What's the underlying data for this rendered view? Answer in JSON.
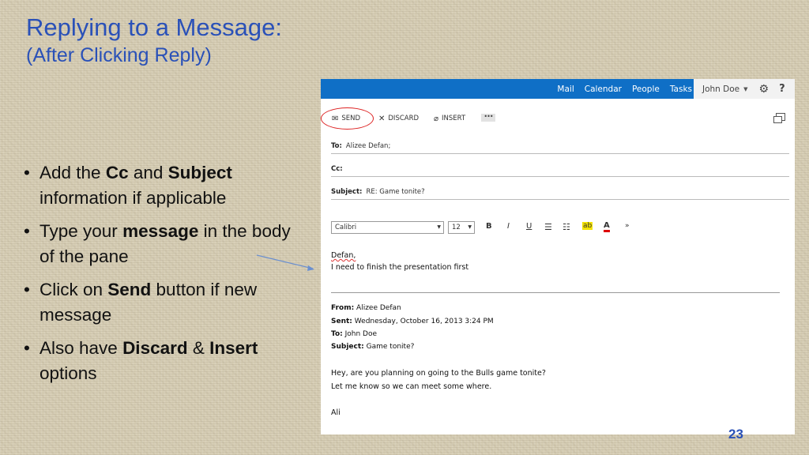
{
  "slide": {
    "title_line1": "Replying to a Message:",
    "title_line2": "(After Clicking Reply)",
    "bullets": [
      {
        "pre": "Add the ",
        "b1": "Cc",
        "mid": " and ",
        "b2": "Subject",
        "post": " information if applicable"
      },
      {
        "pre": "Type your ",
        "b1": "message",
        "post": " in the body of the pane"
      },
      {
        "pre": "Click on ",
        "b1": "Send",
        "post": " button if new message"
      },
      {
        "pre": "Also have ",
        "b1": "Discard",
        "mid": " & ",
        "b2": "Insert",
        "post": " options"
      }
    ],
    "page_number": "23"
  },
  "outlook": {
    "nav": [
      "Mail",
      "Calendar",
      "People",
      "Tasks"
    ],
    "user": "John Doe",
    "toolbar": {
      "send": "SEND",
      "discard": "DISCARD",
      "insert": "INSERT",
      "more": "•••"
    },
    "to_label": "To:",
    "to_value": "Alizee Defan;",
    "cc_label": "Cc:",
    "subject_label": "Subject:",
    "subject_value": "RE: Game tonite?",
    "font_name": "Calibri",
    "font_size": "12",
    "format_buttons": [
      "B",
      "I",
      "U"
    ],
    "body_line1": "Defan,",
    "body_line2": "I need to finish the presentation first",
    "quoted": {
      "from_label": "From:",
      "from": "Alizee Defan",
      "sent_label": "Sent:",
      "sent": "Wednesday, October 16, 2013 3:24 PM",
      "to_label": "To:",
      "to": "John Doe",
      "subject_label": "Subject:",
      "subject": "Game tonite?",
      "line1": "Hey, are you planning on going to the Bulls game tonite?",
      "line2": "Let me know so we can meet some where.",
      "sign": "Ali"
    }
  },
  "colors": {
    "title": "#2a51b8",
    "topbar": "#0f6fc6",
    "send_circle": "#dd2222",
    "background": "#d6cdb4"
  }
}
